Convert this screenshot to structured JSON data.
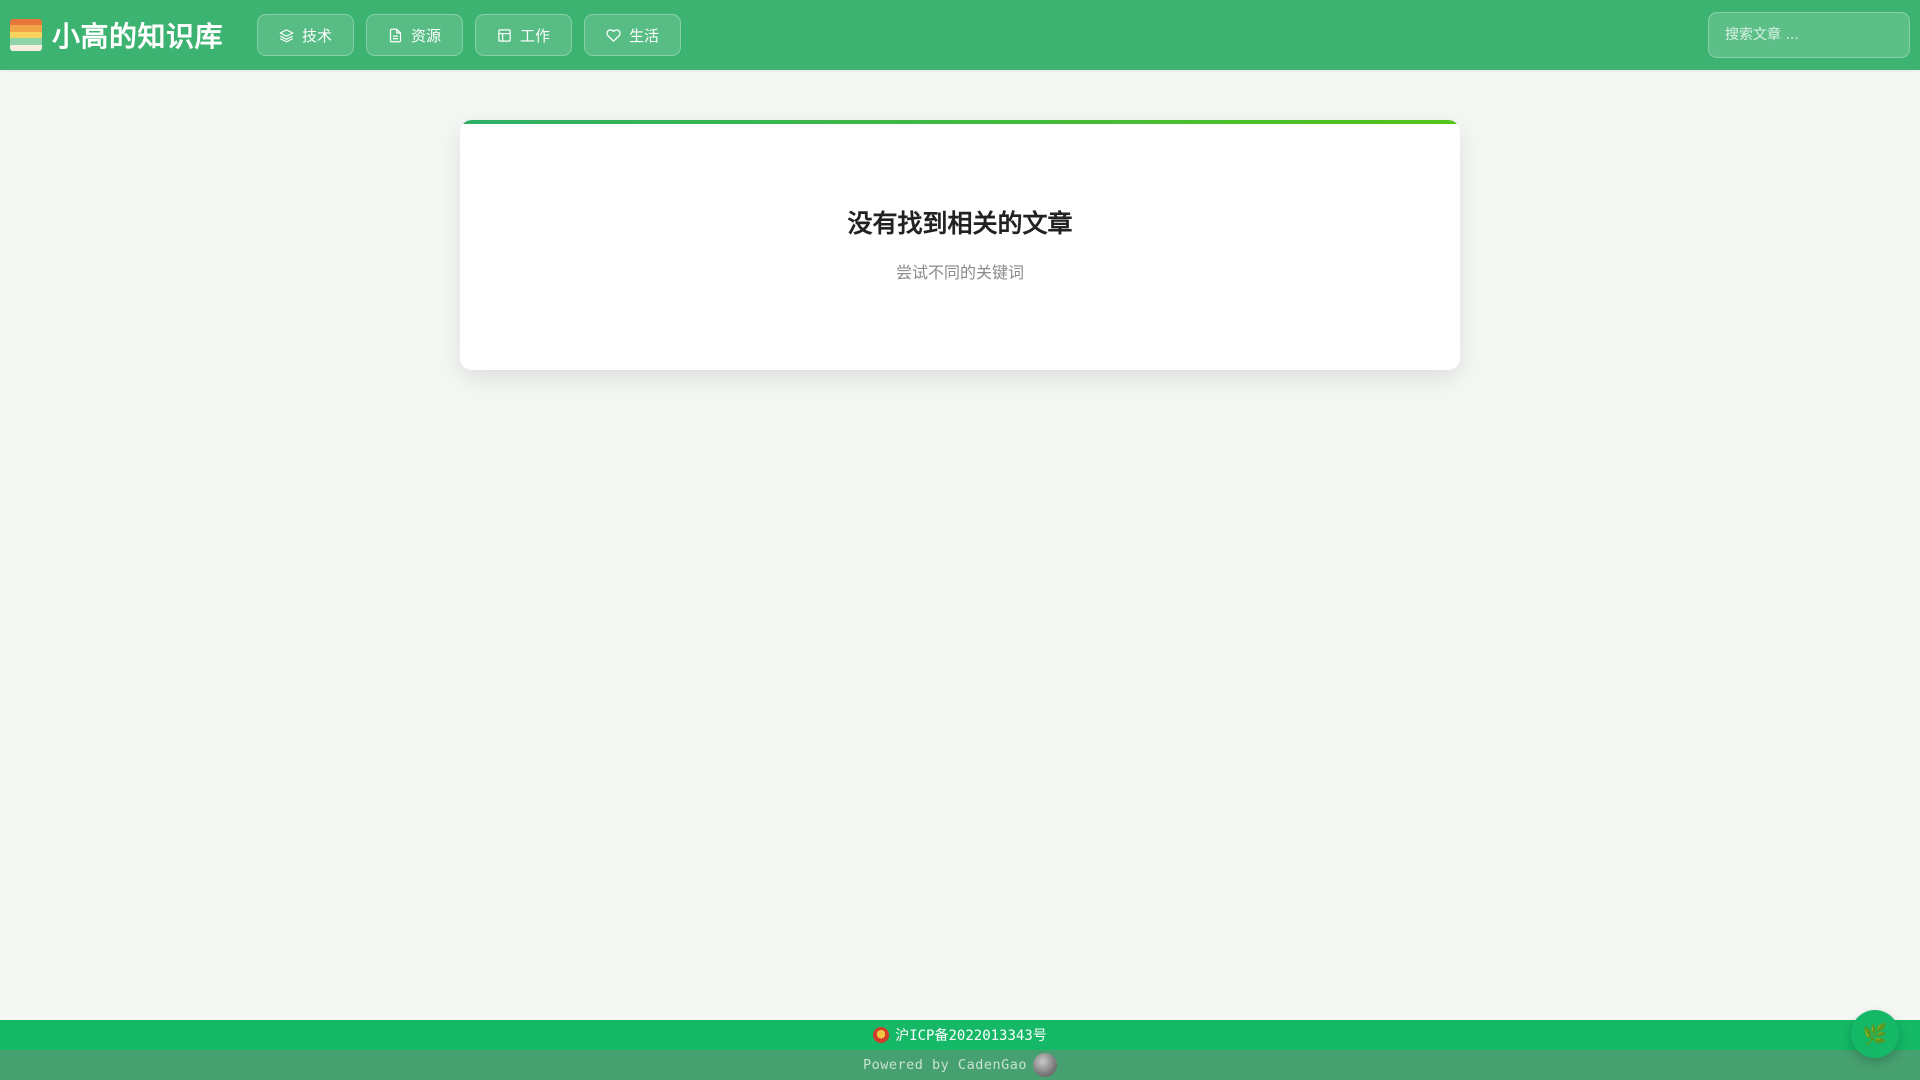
{
  "header": {
    "brand_title": "小高的知识库",
    "nav": [
      {
        "label": "技术",
        "icon": "layers-icon"
      },
      {
        "label": "资源",
        "icon": "file-icon"
      },
      {
        "label": "工作",
        "icon": "layout-icon"
      },
      {
        "label": "生活",
        "icon": "heart-icon"
      }
    ],
    "search_placeholder": "搜索文章 ..."
  },
  "main": {
    "empty_title": "没有找到相关的文章",
    "empty_subtitle": "尝试不同的关键词"
  },
  "footer": {
    "icp": "沪ICP备2022013343号",
    "powered": "Powered by CadenGao"
  },
  "fab": {
    "icon": "leaf-icon",
    "glyph": "🌿"
  },
  "colors": {
    "navbar": "#3cb371",
    "footer_top": "#14b866",
    "footer_bottom": "#46a06f",
    "card_accent": "#52c41a"
  }
}
